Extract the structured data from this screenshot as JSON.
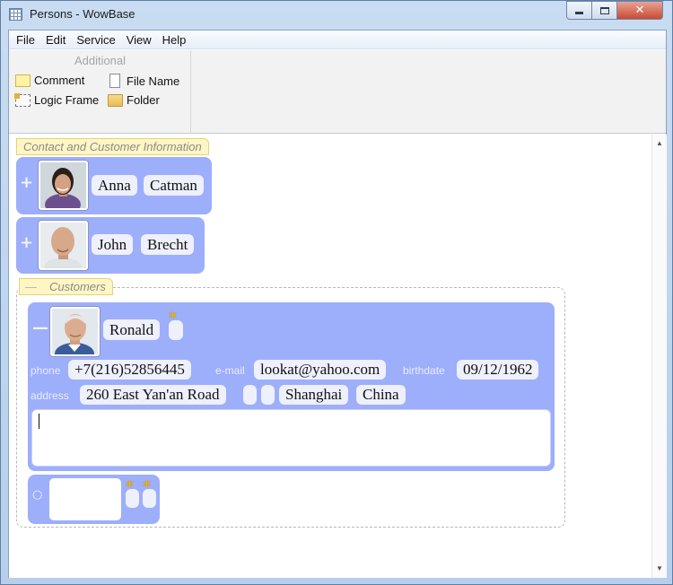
{
  "window": {
    "title": "Persons - WowBase",
    "close_glyph": "✕"
  },
  "menu": [
    "File",
    "Edit",
    "Service",
    "View",
    "Help"
  ],
  "ribbon": {
    "group_title": "Additional",
    "buttons": [
      {
        "label": "Comment",
        "icon": "comment-icon"
      },
      {
        "label": "File Name",
        "icon": "file-icon"
      },
      {
        "label": "Logic Frame",
        "icon": "logic-frame-icon"
      },
      {
        "label": "Folder",
        "icon": "folder-icon"
      }
    ]
  },
  "content": {
    "section_label": "Contact and Customer Information",
    "persons": [
      {
        "first_name": "Anna",
        "last_name": "Catman",
        "expander": "+"
      },
      {
        "first_name": "John",
        "last_name": "Brecht",
        "expander": "+"
      }
    ],
    "customers": {
      "label": "Customers",
      "expander": "—",
      "record": {
        "expander": "—",
        "first_name": "Ronald",
        "required_mark": "*",
        "phone_label": "phone",
        "phone": "+7(216)52856445",
        "email_label": "e-mail",
        "email": "lookat@yahoo.com",
        "birthdate_label": "birthdate",
        "birthdate": "09/12/1962",
        "address_label": "address",
        "street": "260 East Yan'an Road",
        "city": "Shanghai",
        "country": "China",
        "notes": ""
      },
      "new_record": {
        "expander": "○",
        "required_mark": "*"
      }
    }
  },
  "colors": {
    "card": "#9daefb",
    "pill": "#eef0fc",
    "tag": "#fff6c4",
    "star": "#f1b500"
  }
}
